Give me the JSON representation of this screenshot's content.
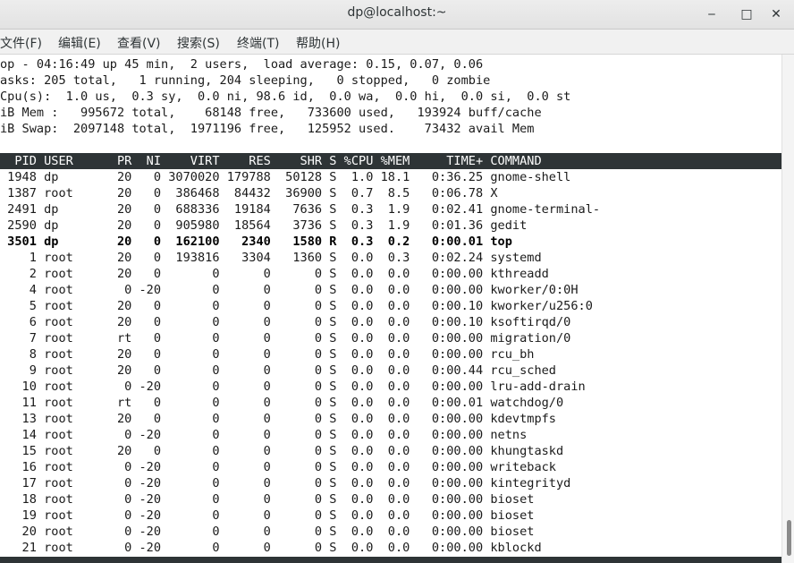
{
  "window": {
    "title": "dp@localhost:~",
    "minimize": "‒",
    "maximize": "□",
    "close": "✕"
  },
  "menu": [
    "文件(F)",
    "编辑(E)",
    "查看(V)",
    "搜索(S)",
    "终端(T)",
    "帮助(H)"
  ],
  "summary": [
    "op - 04:16:49 up 45 min,  2 users,  load average: 0.15, 0.07, 0.06",
    "asks: 205 total,   1 running, 204 sleeping,   0 stopped,   0 zombie",
    "Cpu(s):  1.0 us,  0.3 sy,  0.0 ni, 98.6 id,  0.0 wa,  0.0 hi,  0.0 si,  0.0 st",
    "iB Mem :   995672 total,    68148 free,   733600 used,   193924 buff/cache",
    "iB Swap:  2097148 total,  1971196 free,   125952 used.    73432 avail Mem"
  ],
  "columns_header": "  PID USER      PR  NI    VIRT    RES    SHR S %CPU %MEM     TIME+ COMMAND",
  "processes": [
    {
      "pid": "1948",
      "user": "dp",
      "pr": "20",
      "ni": "0",
      "virt": "3070020",
      "res": "179788",
      "shr": "50128",
      "s": "S",
      "cpu": "1.0",
      "mem": "18.1",
      "time": "0:36.25",
      "command": "gnome-shell",
      "bold": false
    },
    {
      "pid": "1387",
      "user": "root",
      "pr": "20",
      "ni": "0",
      "virt": "386468",
      "res": "84432",
      "shr": "36900",
      "s": "S",
      "cpu": "0.7",
      "mem": "8.5",
      "time": "0:06.78",
      "command": "X",
      "bold": false
    },
    {
      "pid": "2491",
      "user": "dp",
      "pr": "20",
      "ni": "0",
      "virt": "688336",
      "res": "19184",
      "shr": "7636",
      "s": "S",
      "cpu": "0.3",
      "mem": "1.9",
      "time": "0:02.41",
      "command": "gnome-terminal-",
      "bold": false
    },
    {
      "pid": "2590",
      "user": "dp",
      "pr": "20",
      "ni": "0",
      "virt": "905980",
      "res": "18564",
      "shr": "3736",
      "s": "S",
      "cpu": "0.3",
      "mem": "1.9",
      "time": "0:01.36",
      "command": "gedit",
      "bold": false
    },
    {
      "pid": "3501",
      "user": "dp",
      "pr": "20",
      "ni": "0",
      "virt": "162100",
      "res": "2340",
      "shr": "1580",
      "s": "R",
      "cpu": "0.3",
      "mem": "0.2",
      "time": "0:00.01",
      "command": "top",
      "bold": true
    },
    {
      "pid": "1",
      "user": "root",
      "pr": "20",
      "ni": "0",
      "virt": "193816",
      "res": "3304",
      "shr": "1360",
      "s": "S",
      "cpu": "0.0",
      "mem": "0.3",
      "time": "0:02.24",
      "command": "systemd",
      "bold": false
    },
    {
      "pid": "2",
      "user": "root",
      "pr": "20",
      "ni": "0",
      "virt": "0",
      "res": "0",
      "shr": "0",
      "s": "S",
      "cpu": "0.0",
      "mem": "0.0",
      "time": "0:00.00",
      "command": "kthreadd",
      "bold": false
    },
    {
      "pid": "4",
      "user": "root",
      "pr": "0",
      "ni": "-20",
      "virt": "0",
      "res": "0",
      "shr": "0",
      "s": "S",
      "cpu": "0.0",
      "mem": "0.0",
      "time": "0:00.00",
      "command": "kworker/0:0H",
      "bold": false
    },
    {
      "pid": "5",
      "user": "root",
      "pr": "20",
      "ni": "0",
      "virt": "0",
      "res": "0",
      "shr": "0",
      "s": "S",
      "cpu": "0.0",
      "mem": "0.0",
      "time": "0:00.10",
      "command": "kworker/u256:0",
      "bold": false
    },
    {
      "pid": "6",
      "user": "root",
      "pr": "20",
      "ni": "0",
      "virt": "0",
      "res": "0",
      "shr": "0",
      "s": "S",
      "cpu": "0.0",
      "mem": "0.0",
      "time": "0:00.10",
      "command": "ksoftirqd/0",
      "bold": false
    },
    {
      "pid": "7",
      "user": "root",
      "pr": "rt",
      "ni": "0",
      "virt": "0",
      "res": "0",
      "shr": "0",
      "s": "S",
      "cpu": "0.0",
      "mem": "0.0",
      "time": "0:00.00",
      "command": "migration/0",
      "bold": false
    },
    {
      "pid": "8",
      "user": "root",
      "pr": "20",
      "ni": "0",
      "virt": "0",
      "res": "0",
      "shr": "0",
      "s": "S",
      "cpu": "0.0",
      "mem": "0.0",
      "time": "0:00.00",
      "command": "rcu_bh",
      "bold": false
    },
    {
      "pid": "9",
      "user": "root",
      "pr": "20",
      "ni": "0",
      "virt": "0",
      "res": "0",
      "shr": "0",
      "s": "S",
      "cpu": "0.0",
      "mem": "0.0",
      "time": "0:00.44",
      "command": "rcu_sched",
      "bold": false
    },
    {
      "pid": "10",
      "user": "root",
      "pr": "0",
      "ni": "-20",
      "virt": "0",
      "res": "0",
      "shr": "0",
      "s": "S",
      "cpu": "0.0",
      "mem": "0.0",
      "time": "0:00.00",
      "command": "lru-add-drain",
      "bold": false
    },
    {
      "pid": "11",
      "user": "root",
      "pr": "rt",
      "ni": "0",
      "virt": "0",
      "res": "0",
      "shr": "0",
      "s": "S",
      "cpu": "0.0",
      "mem": "0.0",
      "time": "0:00.01",
      "command": "watchdog/0",
      "bold": false
    },
    {
      "pid": "13",
      "user": "root",
      "pr": "20",
      "ni": "0",
      "virt": "0",
      "res": "0",
      "shr": "0",
      "s": "S",
      "cpu": "0.0",
      "mem": "0.0",
      "time": "0:00.00",
      "command": "kdevtmpfs",
      "bold": false
    },
    {
      "pid": "14",
      "user": "root",
      "pr": "0",
      "ni": "-20",
      "virt": "0",
      "res": "0",
      "shr": "0",
      "s": "S",
      "cpu": "0.0",
      "mem": "0.0",
      "time": "0:00.00",
      "command": "netns",
      "bold": false
    },
    {
      "pid": "15",
      "user": "root",
      "pr": "20",
      "ni": "0",
      "virt": "0",
      "res": "0",
      "shr": "0",
      "s": "S",
      "cpu": "0.0",
      "mem": "0.0",
      "time": "0:00.00",
      "command": "khungtaskd",
      "bold": false
    },
    {
      "pid": "16",
      "user": "root",
      "pr": "0",
      "ni": "-20",
      "virt": "0",
      "res": "0",
      "shr": "0",
      "s": "S",
      "cpu": "0.0",
      "mem": "0.0",
      "time": "0:00.00",
      "command": "writeback",
      "bold": false
    },
    {
      "pid": "17",
      "user": "root",
      "pr": "0",
      "ni": "-20",
      "virt": "0",
      "res": "0",
      "shr": "0",
      "s": "S",
      "cpu": "0.0",
      "mem": "0.0",
      "time": "0:00.00",
      "command": "kintegrityd",
      "bold": false
    },
    {
      "pid": "18",
      "user": "root",
      "pr": "0",
      "ni": "-20",
      "virt": "0",
      "res": "0",
      "shr": "0",
      "s": "S",
      "cpu": "0.0",
      "mem": "0.0",
      "time": "0:00.00",
      "command": "bioset",
      "bold": false
    },
    {
      "pid": "19",
      "user": "root",
      "pr": "0",
      "ni": "-20",
      "virt": "0",
      "res": "0",
      "shr": "0",
      "s": "S",
      "cpu": "0.0",
      "mem": "0.0",
      "time": "0:00.00",
      "command": "bioset",
      "bold": false
    },
    {
      "pid": "20",
      "user": "root",
      "pr": "0",
      "ni": "-20",
      "virt": "0",
      "res": "0",
      "shr": "0",
      "s": "S",
      "cpu": "0.0",
      "mem": "0.0",
      "time": "0:00.00",
      "command": "bioset",
      "bold": false
    },
    {
      "pid": "21",
      "user": "root",
      "pr": "0",
      "ni": "-20",
      "virt": "0",
      "res": "0",
      "shr": "0",
      "s": "S",
      "cpu": "0.0",
      "mem": "0.0",
      "time": "0:00.00",
      "command": "kblockd",
      "bold": false
    }
  ]
}
